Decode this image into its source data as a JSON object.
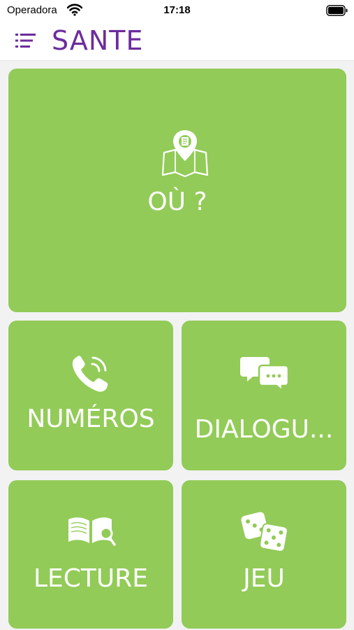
{
  "status_bar": {
    "carrier": "Operadora",
    "time": "17:18"
  },
  "header": {
    "title": "SANTE",
    "title_color": "#6c2c9c"
  },
  "tiles": [
    {
      "label": "OÙ ?",
      "icon": "map-pin-icon"
    },
    {
      "label": "NUMÉROS",
      "icon": "phone-icon"
    },
    {
      "label": "DIALOGU...",
      "icon": "chat-bubbles-icon"
    },
    {
      "label": "LECTURE",
      "icon": "book-search-icon"
    },
    {
      "label": "JEU",
      "icon": "dice-icon"
    }
  ],
  "colors": {
    "tile_background": "#92cb58",
    "page_background": "#f2f2f2"
  }
}
